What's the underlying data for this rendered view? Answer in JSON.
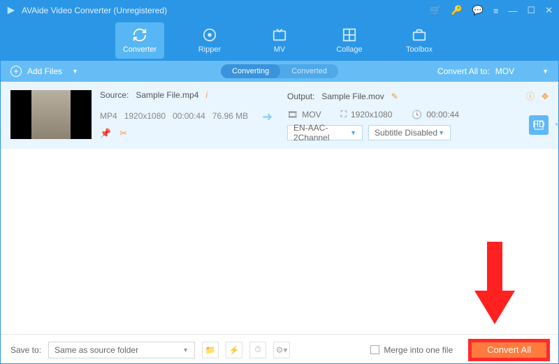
{
  "title": "AVAide Video Converter (Unregistered)",
  "nav": {
    "converter": "Converter",
    "ripper": "Ripper",
    "mv": "MV",
    "collage": "Collage",
    "toolbox": "Toolbox"
  },
  "subbar": {
    "addfiles": "Add Files",
    "converting": "Converting",
    "converted": "Converted",
    "convertall_label": "Convert All to:",
    "convertall_format": "MOV"
  },
  "file": {
    "source_label": "Source:",
    "source_name": "Sample File.mp4",
    "container": "MP4",
    "resolution": "1920x1080",
    "duration": "00:00:44",
    "size": "76.96 MB",
    "output_label": "Output:",
    "output_name": "Sample File.mov",
    "out_format": "MOV",
    "out_resolution": "1920x1080",
    "out_duration": "00:00:44",
    "audio_sel": "EN-AAC-2Channel",
    "subtitle_sel": "Subtitle Disabled"
  },
  "footer": {
    "saveto_label": "Save to:",
    "saveto_value": "Same as source folder",
    "merge_label": "Merge into one file",
    "convert_btn": "Convert All"
  }
}
